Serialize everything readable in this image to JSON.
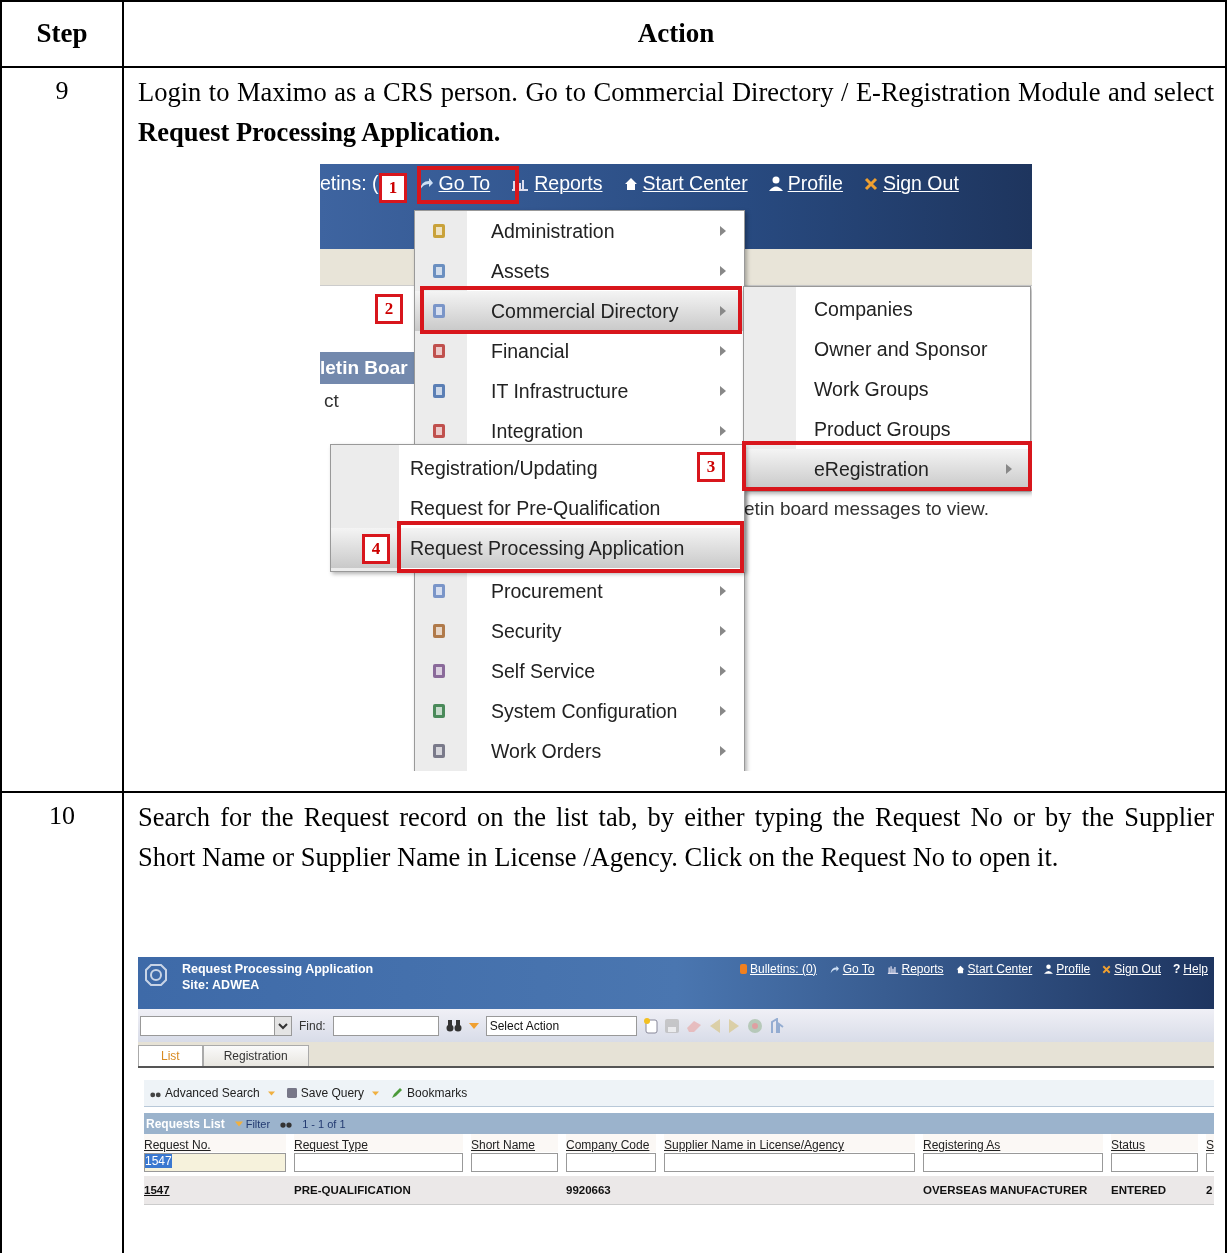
{
  "table": {
    "columns": [
      "Step",
      "Action"
    ],
    "rows": [
      {
        "step": "9",
        "instruction": "Login to Maximo as a CRS person. Go to Commercial Directory / E-Registration Module and select **Request Processing Application.**",
        "screenshot": {
          "kind": "menu",
          "top_links": [
            "etins: (",
            "Go To",
            "Reports",
            "Start Center",
            "Profile",
            "Sign Out"
          ],
          "background_texts": [
            "letin Boar",
            "ct",
            "etin board messages to view."
          ],
          "main_menu": [
            {
              "label": "Administration",
              "selected": false
            },
            {
              "label": "Assets",
              "selected": false
            },
            {
              "label": "Commercial Directory",
              "selected": true
            },
            {
              "label": "Financial",
              "selected": false
            },
            {
              "label": "IT Infrastructure",
              "selected": false
            },
            {
              "label": "Integration",
              "selected": false
            },
            {
              "label": "Procurement",
              "selected": false
            },
            {
              "label": "Security",
              "selected": false
            },
            {
              "label": "Self Service",
              "selected": false
            },
            {
              "label": "System Configuration",
              "selected": false
            },
            {
              "label": "Work Orders",
              "selected": false
            }
          ],
          "submenu": [
            {
              "label": "Companies",
              "selected": false
            },
            {
              "label": "Owner and Sponsor",
              "selected": false
            },
            {
              "label": "Work Groups",
              "selected": false
            },
            {
              "label": "Product Groups",
              "selected": false
            },
            {
              "label": "eRegistration",
              "selected": true
            }
          ],
          "subsubmenu": [
            {
              "label": "Registration/Updating",
              "selected": false
            },
            {
              "label": "Request for Pre-Qualification",
              "selected": false
            },
            {
              "label": "Request Processing Application",
              "selected": true
            }
          ],
          "callouts": [
            "1",
            "2",
            "3",
            "4"
          ]
        }
      },
      {
        "step": "10",
        "instruction": "Search for the Request record on the list tab, by either typing the Request No or by the Supplier Short Name or Supplier Name in License /Agency. Click on the Request No to open it.",
        "screenshot": {
          "kind": "list",
          "app_title": "Request Processing Application",
          "site": "Site: ADWEA",
          "top_links": [
            {
              "label": "Bulletins: (0)"
            },
            {
              "label": "Go To"
            },
            {
              "label": "Reports"
            },
            {
              "label": "Start Center"
            },
            {
              "label": "Profile"
            },
            {
              "label": "Sign Out"
            },
            {
              "label": "Help",
              "glyph": "?"
            }
          ],
          "find_label": "Find:",
          "action_select": "Select Action",
          "tabs": [
            {
              "label": "List",
              "selected": true
            },
            {
              "label": "Registration",
              "selected": false
            }
          ],
          "search_actions": [
            "Advanced Search",
            "Save Query",
            "Bookmarks"
          ],
          "list_title": "Requests List",
          "filter_label": "Filter",
          "pager": "1 - 1 of 1",
          "columns": [
            {
              "label": "Request No.",
              "filter": "1547"
            },
            {
              "label": "Request Type"
            },
            {
              "label": "Short Name"
            },
            {
              "label": "Company Code"
            },
            {
              "label": "Supplier Name in License/Agency"
            },
            {
              "label": "Registering As"
            },
            {
              "label": "Status"
            },
            {
              "label": "S"
            }
          ],
          "rows": [
            {
              "cells": [
                "1547",
                "PRE-QUALIFICATION",
                null,
                "9920663",
                null,
                "OVERSEAS MANUFACTURER",
                "ENTERED",
                "2"
              ]
            }
          ]
        }
      }
    ]
  }
}
